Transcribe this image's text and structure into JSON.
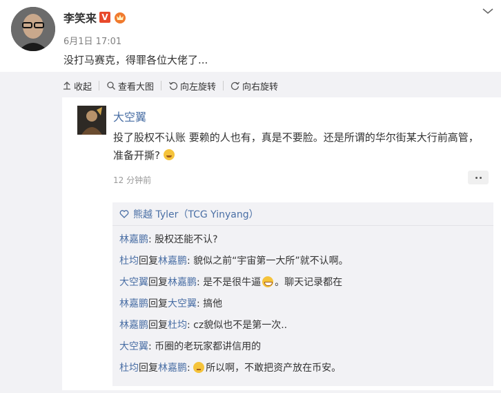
{
  "post": {
    "author": "李笑来",
    "verified_badge": "V",
    "time": "6月1日 17:01",
    "text": "没打马赛克，得罪各位大佬了..."
  },
  "toolbar": {
    "collapse": "收起",
    "view_large": "查看大图",
    "rotate_left": "向左旋转",
    "rotate_right": "向右旋转"
  },
  "comment": {
    "author": "大空翼",
    "text": "投了股权不认账 要赖的人也有，真是不要脸。还是所谓的华尔街某大行前高管，准备开撕?",
    "time": "12 分钟前"
  },
  "thread": {
    "title": "熊越 Tyler（TCG Yinyang）",
    "replies": [
      {
        "user": "林嘉鹏",
        "reply_word": "",
        "target": "",
        "text": ": 股权还能不认?"
      },
      {
        "user": "杜均",
        "reply_word": "回复",
        "target": "林嘉鹏",
        "text": ": 貌似之前“宇宙第一大所”就不认啊。"
      },
      {
        "user": "大空翼",
        "reply_word": "回复",
        "target": "林嘉鹏",
        "text": ": 是不是很牛逼",
        "text2": "。聊天记录都在"
      },
      {
        "user": "林嘉鹏",
        "reply_word": "回复",
        "target": "大空翼",
        "text": ": 搞他"
      },
      {
        "user": "林嘉鹏",
        "reply_word": "回复",
        "target": "杜均",
        "text": ": cz貌似也不是第一次.."
      },
      {
        "user": "大空翼",
        "reply_word": "",
        "target": "",
        "text": ": 币圈的老玩家都讲信用的"
      },
      {
        "user": "杜均",
        "reply_word": "回复",
        "target": "林嘉鹏",
        "text": ": ",
        "text2": "所以啊，不敢把资产放在币安。"
      }
    ]
  },
  "colors": {
    "link": "#4a6fa5",
    "panel": "#f2f2f5",
    "verified": "#e8492b"
  }
}
